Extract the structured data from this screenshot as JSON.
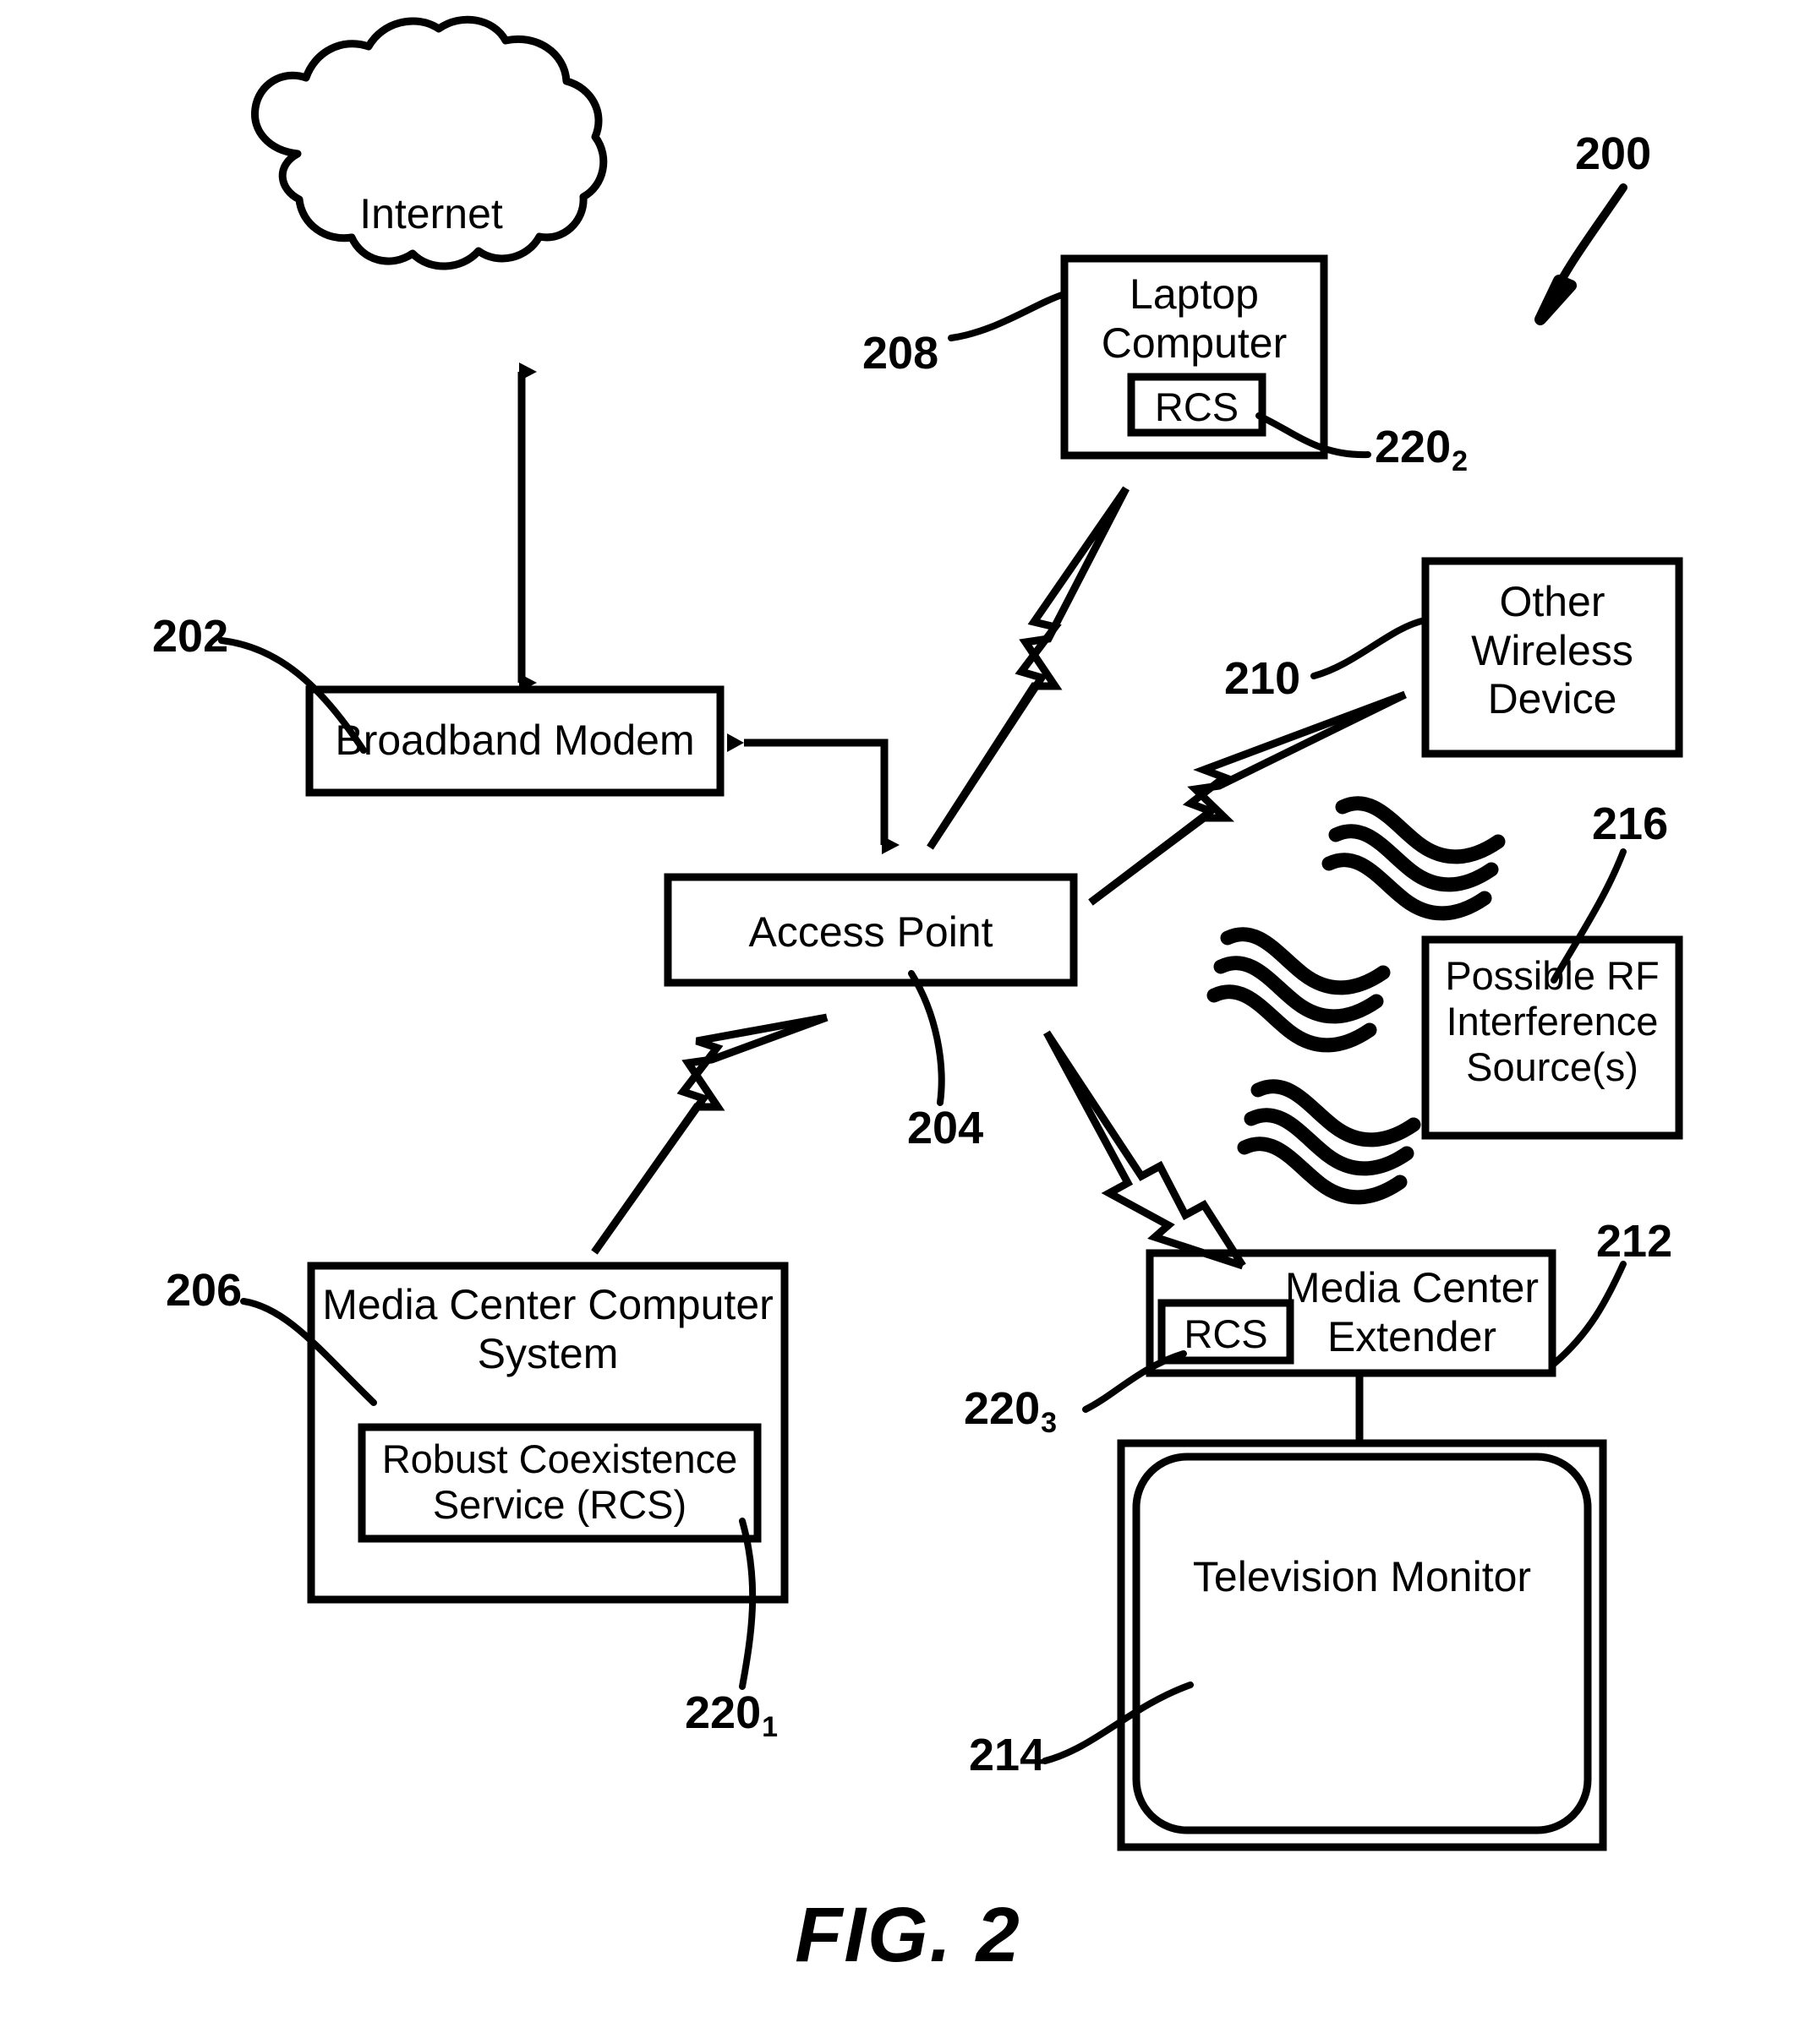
{
  "figure": {
    "caption": "FIG. 2",
    "system_reference": "200"
  },
  "nodes": {
    "internet": {
      "label": "Internet",
      "shape": "cloud"
    },
    "broadband_modem": {
      "label": "Broadband Modem",
      "ref": "202"
    },
    "access_point": {
      "label": "Access Point",
      "ref": "204"
    },
    "laptop_computer": {
      "label": "Laptop\nComputer",
      "ref": "208",
      "inner": {
        "label": "RCS",
        "ref_base": "220",
        "ref_sub": "2"
      }
    },
    "other_wireless_device": {
      "label": "Other\nWireless\nDevice",
      "ref": "210"
    },
    "rf_interference": {
      "label": "Possible RF\nInterference\nSource(s)",
      "ref": "216"
    },
    "media_center_computer": {
      "label": "Media Center Computer\nSystem",
      "ref": "206",
      "inner": {
        "label": "Robust Coexistence\nService (RCS)",
        "ref_base": "220",
        "ref_sub": "1"
      }
    },
    "media_center_extender": {
      "label": "Media Center\nExtender",
      "ref": "212",
      "inner": {
        "label": "RCS",
        "ref_base": "220",
        "ref_sub": "3"
      }
    },
    "television_monitor": {
      "label": "Television Monitor",
      "ref": "214"
    }
  },
  "connections": [
    {
      "name": "internet-modem",
      "type": "double-arrow",
      "from": "internet",
      "to": "broadband_modem"
    },
    {
      "name": "modem-access-point",
      "type": "double-arrow-elbow",
      "from": "broadband_modem",
      "to": "access_point"
    },
    {
      "name": "ap-laptop",
      "type": "lightning",
      "from": "access_point",
      "to": "laptop_computer"
    },
    {
      "name": "ap-other-wireless",
      "type": "lightning",
      "from": "access_point",
      "to": "other_wireless_device"
    },
    {
      "name": "ap-media-center-computer",
      "type": "lightning",
      "from": "access_point",
      "to": "media_center_computer"
    },
    {
      "name": "ap-media-center-extender",
      "type": "lightning",
      "from": "access_point",
      "to": "media_center_extender"
    },
    {
      "name": "extender-tv",
      "type": "line",
      "from": "media_center_extender",
      "to": "television_monitor"
    }
  ],
  "interference_waves": {
    "name": "rf-wave-symbols",
    "count": 3,
    "strokes_per_symbol": 3
  },
  "colors": {
    "ink": "#000000",
    "background": "#ffffff"
  }
}
